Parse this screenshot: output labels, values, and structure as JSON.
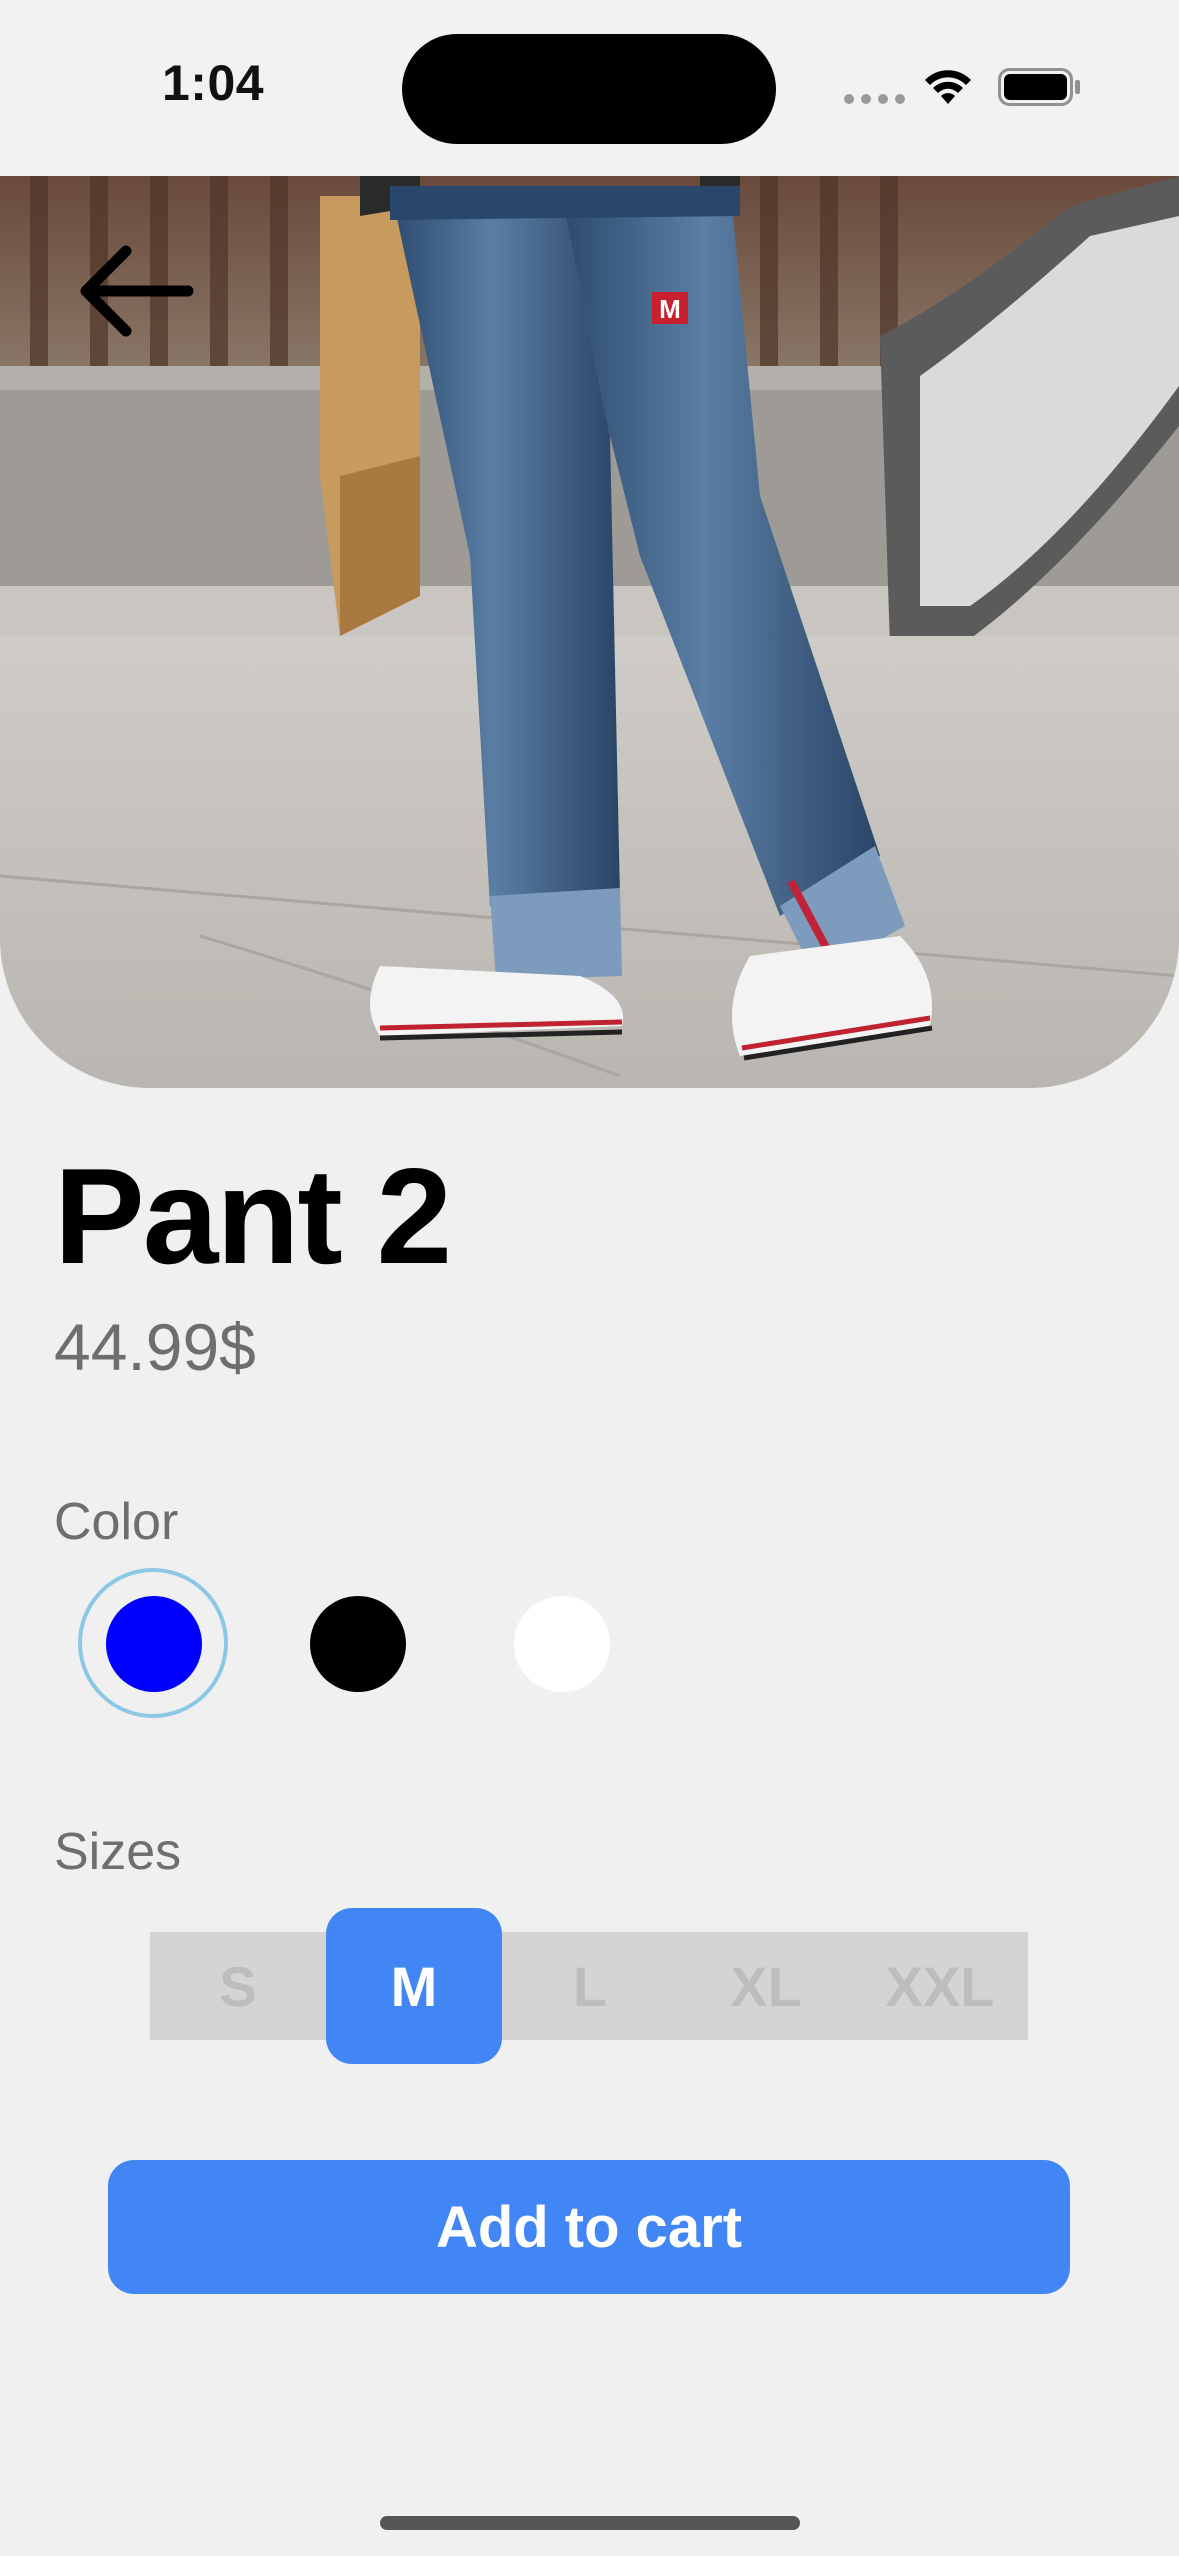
{
  "status_bar": {
    "time": "1:04",
    "icons": [
      "cellular-dots-icon",
      "wifi-icon",
      "battery-icon"
    ]
  },
  "hero": {
    "image": "product-photo-jeans",
    "brand_tag": "M",
    "back_icon": "arrow-left-icon"
  },
  "product": {
    "title": "Pant 2",
    "price": "44.99$"
  },
  "color_section": {
    "label": "Color",
    "options": [
      {
        "name": "blue",
        "hex": "#0000ff",
        "selected": true
      },
      {
        "name": "black",
        "hex": "#000000",
        "selected": false
      },
      {
        "name": "white",
        "hex": "#ffffff",
        "selected": false
      }
    ],
    "selection_ring_color": "#8cc8e6"
  },
  "size_section": {
    "label": "Sizes",
    "options": [
      "S",
      "M",
      "L",
      "XL",
      "XXL"
    ],
    "selected": "M"
  },
  "actions": {
    "add_to_cart": "Add to cart"
  },
  "colors": {
    "accent": "#4285f4",
    "background": "#f0f0f0",
    "muted_text": "#6e6e6e",
    "unselected_size_text": "#bdbdbd",
    "size_track": "#d4d4d4"
  }
}
